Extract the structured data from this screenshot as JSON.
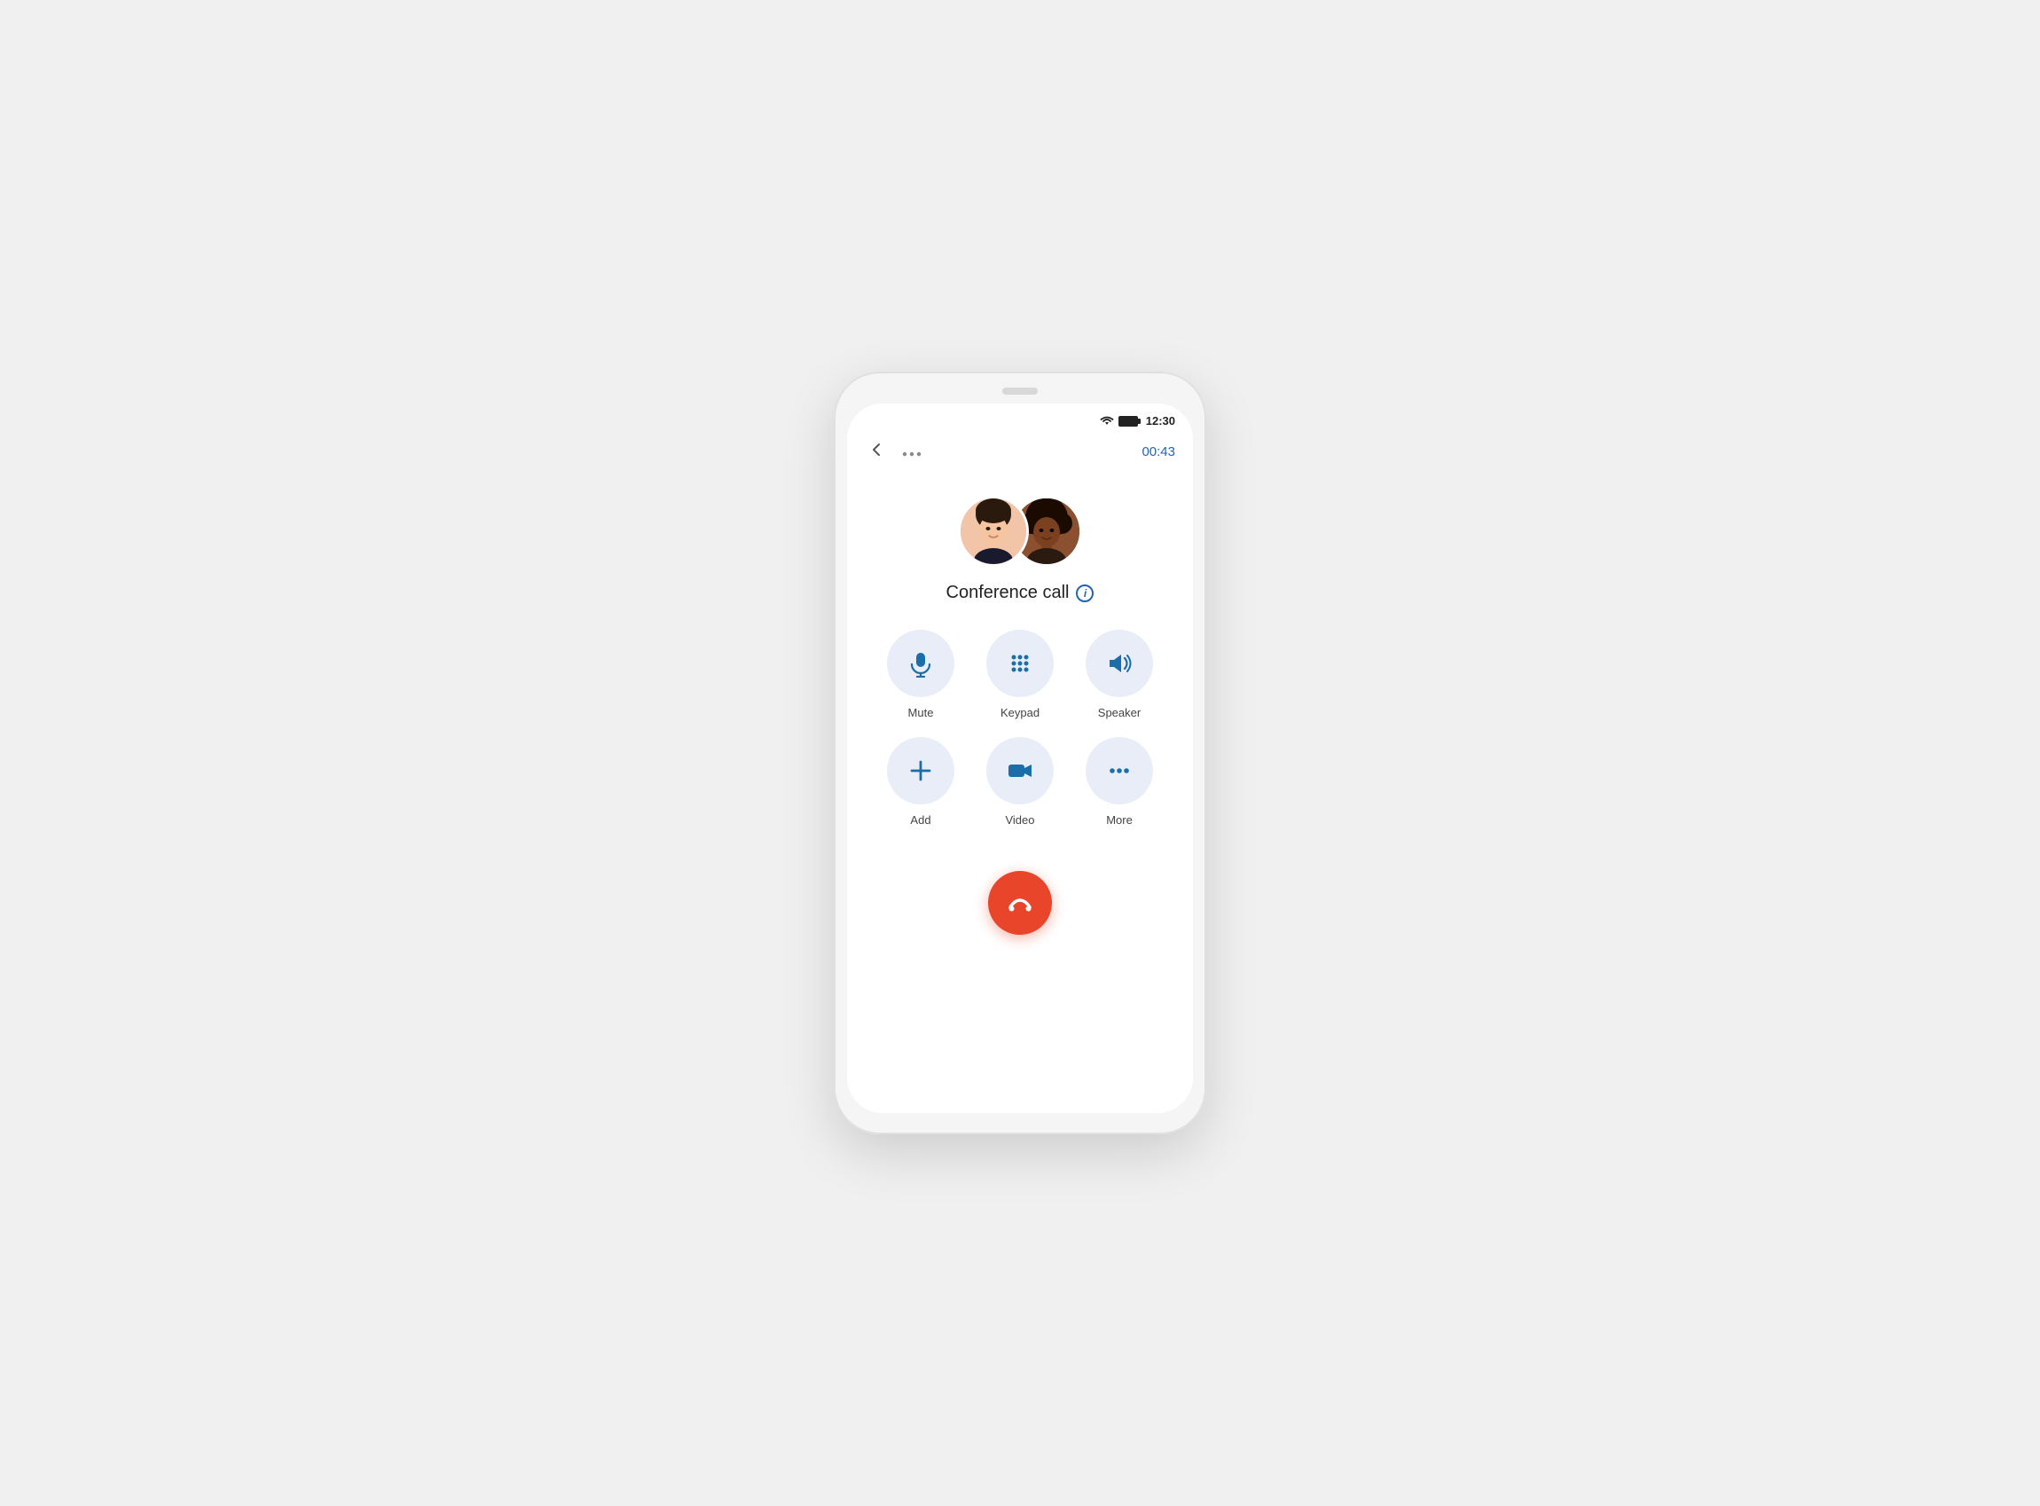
{
  "statusBar": {
    "time": "12:30"
  },
  "topBar": {
    "backLabel": "‹",
    "moreDotsLabel": "···",
    "callTimer": "00:43"
  },
  "callScreen": {
    "title": "Conference call",
    "infoIconLabel": "i"
  },
  "controls": [
    {
      "id": "mute",
      "label": "Mute",
      "icon": "mic"
    },
    {
      "id": "keypad",
      "label": "Keypad",
      "icon": "keypad"
    },
    {
      "id": "speaker",
      "label": "Speaker",
      "icon": "speaker"
    },
    {
      "id": "add",
      "label": "Add",
      "icon": "plus"
    },
    {
      "id": "video",
      "label": "Video",
      "icon": "video"
    },
    {
      "id": "more",
      "label": "More",
      "icon": "threedots"
    }
  ],
  "endCall": {
    "label": "End Call"
  }
}
